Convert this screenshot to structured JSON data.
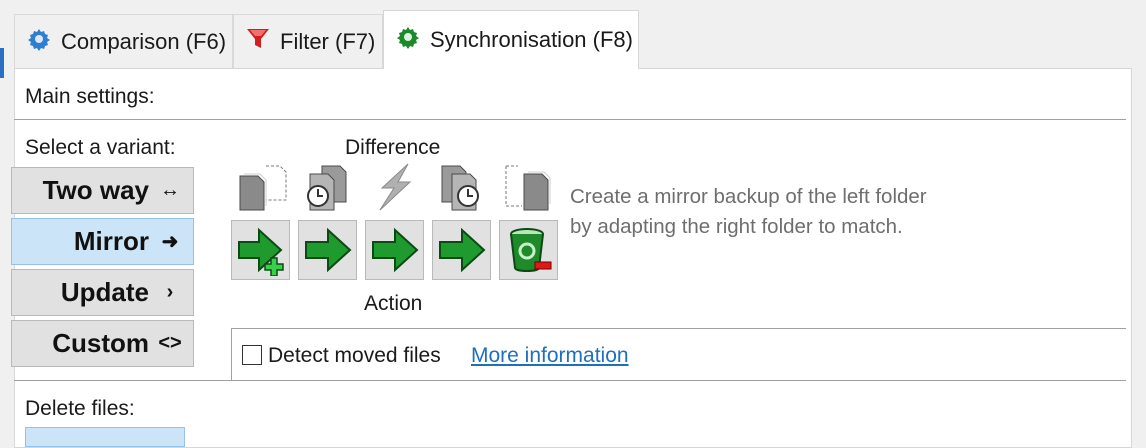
{
  "tabs": [
    {
      "label": "Comparison (F6)",
      "icon": "gear-icon",
      "active": false
    },
    {
      "label": "Filter (F7)",
      "icon": "funnel-icon",
      "active": false
    },
    {
      "label": "Synchronisation (F8)",
      "icon": "gear-icon",
      "active": true
    }
  ],
  "main_settings_label": "Main settings:",
  "select_variant_label": "Select a variant:",
  "variants": [
    {
      "label": "Two way",
      "symbol": "↔",
      "selected": false
    },
    {
      "label": "Mirror",
      "symbol": "➜",
      "selected": true
    },
    {
      "label": "Update",
      "symbol": "›",
      "selected": false
    },
    {
      "label": "Custom",
      "symbol": "<>",
      "selected": false
    }
  ],
  "difference_label": "Difference",
  "action_label": "Action",
  "description": "Create a mirror backup of the left folder by adapting the right folder to match.",
  "detect_moved": {
    "label": "Detect moved files",
    "checked": false
  },
  "more_info_link": "More information",
  "delete_files_label": "Delete files:",
  "colors": {
    "selected_bg": "#cce4f7",
    "link": "#1f6fbf",
    "action_green": "#1f9a2e",
    "tab_gear_blue": "#2f7fd1",
    "tab_gear_green": "#1a8a2a",
    "funnel_red": "#d11f1f"
  }
}
